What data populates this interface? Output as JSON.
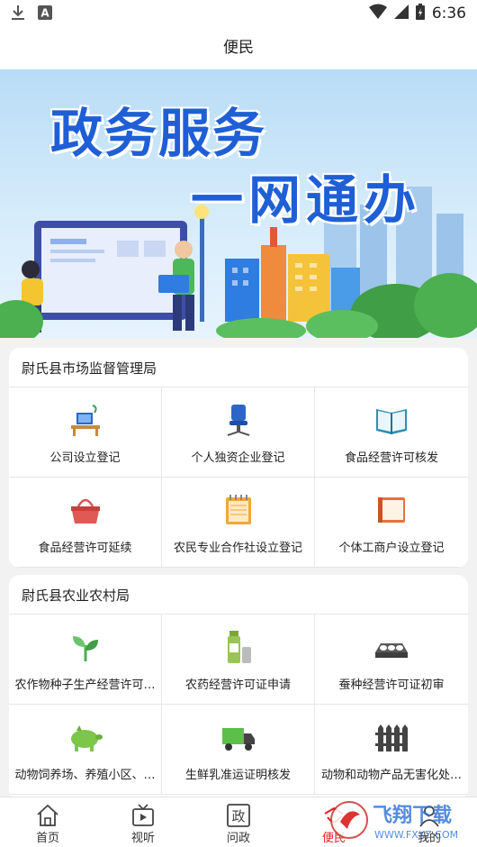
{
  "status_bar": {
    "time": "6:36",
    "icons": [
      "download-icon",
      "a-badge-icon",
      "wifi-icon",
      "signal-icon",
      "battery-icon"
    ]
  },
  "header": {
    "title": "便民"
  },
  "banner": {
    "line1": "政务服务",
    "line2": "一网通办"
  },
  "sections": [
    {
      "title": "尉氏县市场监督管理局",
      "items": [
        {
          "label": "公司设立登记",
          "icon": "desk-computer-icon"
        },
        {
          "label": "个人独资企业登记",
          "icon": "office-chair-icon"
        },
        {
          "label": "食品经营许可核发",
          "icon": "open-book-icon"
        },
        {
          "label": "食品经营许可延续",
          "icon": "shopping-basket-icon"
        },
        {
          "label": "农民专业合作社设立登记",
          "icon": "notepad-icon"
        },
        {
          "label": "个体工商户设立登记",
          "icon": "notebook-icon"
        }
      ]
    },
    {
      "title": "尉氏县农业农村局",
      "items": [
        {
          "label": "农作物种子生产经营许可…",
          "icon": "seedling-icon"
        },
        {
          "label": "农药经营许可证申请",
          "icon": "pesticide-bottle-icon"
        },
        {
          "label": "蚕种经营许可证初审",
          "icon": "egg-tray-icon"
        },
        {
          "label": "动物饲养场、养殖小区、…",
          "icon": "pig-icon"
        },
        {
          "label": "生鲜乳准运证明核发",
          "icon": "truck-icon"
        },
        {
          "label": "动物和动物产品无害化处…",
          "icon": "fence-icon"
        }
      ]
    }
  ],
  "tabbar": {
    "items": [
      {
        "label": "首页",
        "icon": "home-icon"
      },
      {
        "label": "视听",
        "icon": "tv-icon"
      },
      {
        "label": "问政",
        "icon": "wenzheng-icon",
        "glyph": "政"
      },
      {
        "label": "便民",
        "icon": "bianmin-icon"
      },
      {
        "label": "我的",
        "icon": "user-icon"
      }
    ],
    "active_index": 3
  },
  "watermark": {
    "text_cn": "飞翔下载",
    "text_en": "WWW.FXXZ.COM"
  },
  "colors": {
    "accent": "#e02020",
    "banner_title": "#1f5fd6",
    "divider": "#e6e6e6"
  }
}
